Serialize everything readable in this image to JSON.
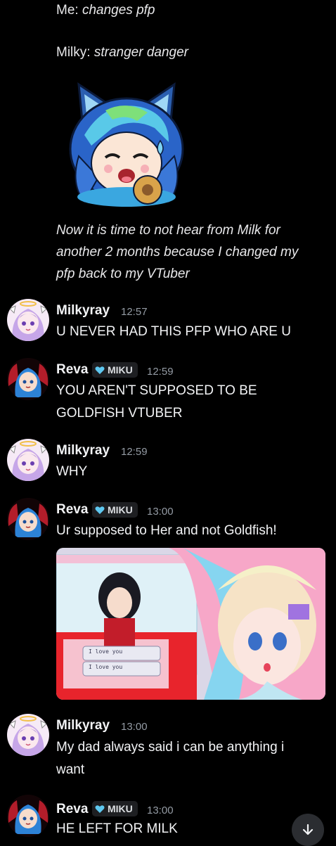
{
  "intro": {
    "line1_speaker": "Me:",
    "line1_text": "changes pfp",
    "line2_speaker": "Milky:",
    "line2_text": "stranger danger",
    "note_lines": [
      "Now it is time to not hear from Milk for",
      "another 2 months because I changed my",
      "pfp back to my VTuber"
    ]
  },
  "messages": [
    {
      "author": "Milkyray",
      "time": "12:57",
      "lines": [
        "U NEVER HAD THIS PFP WHO ARE U"
      ]
    },
    {
      "author": "Reva",
      "tag": "MIKU",
      "time": "12:59",
      "lines": [
        "YOU AREN'T SUPPOSED TO BE",
        "GOLDFISH VTUBER"
      ]
    },
    {
      "author": "Milkyray",
      "time": "12:59",
      "lines": [
        "WHY"
      ]
    },
    {
      "author": "Reva",
      "tag": "MIKU",
      "time": "13:00",
      "lines": [
        "Ur supposed to Her and not Goldfish!"
      ]
    },
    {
      "author": "Milkyray",
      "time": "13:00",
      "lines": [
        "My dad always said i can be anything i",
        "want"
      ]
    },
    {
      "author": "Reva",
      "tag": "MIKU",
      "time": "13:00",
      "lines": [
        "HE LEFT FOR MILK"
      ]
    }
  ],
  "attachment": {
    "chat_lines": [
      "I love you",
      "I love you"
    ]
  },
  "colors": {
    "background": "#000000",
    "timestamp": "#949ba4",
    "badge_bg": "#1e1f22",
    "heart": "#5ec8f0"
  },
  "icons": [
    "cat-vtuber-sticker",
    "milkyray-avatar",
    "reva-avatar",
    "heart-icon",
    "arrow-down-icon"
  ]
}
